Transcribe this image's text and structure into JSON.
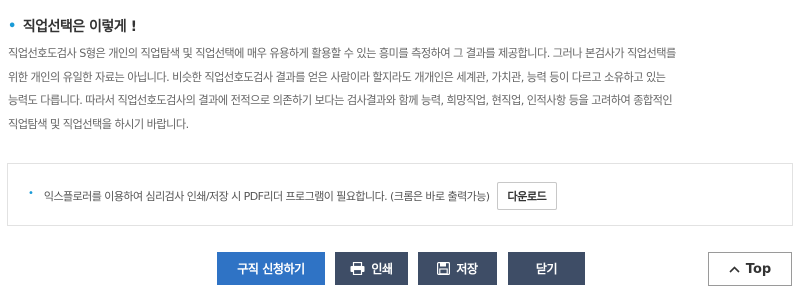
{
  "section": {
    "bullet": "•",
    "title": "직업선택은 이렇게 !"
  },
  "description": {
    "lines": [
      "직업선호도검사 S형은 개인의 직업탐색 및 직업선택에 매우 유용하게 활용할 수 있는 흥미를 측정하여 그 결과를 제공합니다. 그러나 본검사가 직업선택를",
      "위한 개인의 유일한 자료는 아닙니다. 비슷한 직업선호도검사 결과를 얻은 사람이라 할지라도 개개인은 세계관, 가치관, 능력 등이 다르고 소유하고 있는",
      "능력도 다릅니다. 따라서 직업선호도검사의 결과에 전적으로 의존하기 보다는 검사결과와 함께 능력, 희망직업, 현직업, 인적사항 등을 고려하여 종합적인",
      "직업탐색 및 직업선택을 하시기 바랍니다."
    ]
  },
  "notice": {
    "bullet": "•",
    "text": "익스플로러를 이용하여 심리검사 인쇄/저장 시 PDF리더 프로그램이 필요합니다. (크롬은 바로 출력가능)",
    "download_label": "다운로드"
  },
  "buttons": {
    "apply_label": "구직 신청하기",
    "print_label": "인쇄",
    "save_label": "저장",
    "close_label": "닫기",
    "top_label": "Top"
  },
  "colors": {
    "accent": "#1a9bd7",
    "primary_button": "#2f73c5",
    "dark_button": "#3e4d66"
  }
}
